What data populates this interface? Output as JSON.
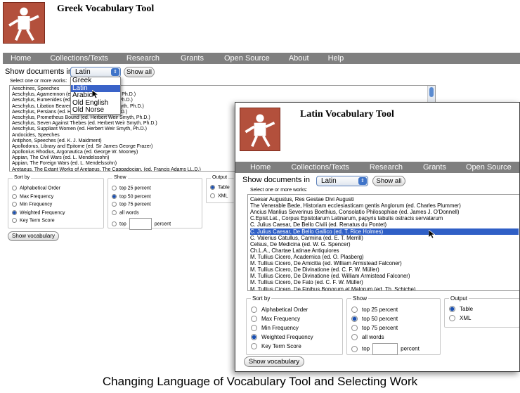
{
  "background": {
    "app_title": "Greek Vocabulary Tool",
    "nav": [
      "Home",
      "Collections/Texts",
      "Research",
      "Grants",
      "Open Source",
      "About",
      "Help"
    ],
    "show_documents_label": "Show documents in",
    "language_value": "Latin",
    "show_all_label": "Show all",
    "works_label": "Select one or more works:",
    "works": [
      "Aeschines, Speeches",
      "Aeschylus, Agamemnon (ed. Herbert Weir Smyth, Ph.D.)",
      "Aeschylus, Eumenides (ed. Herbert Weir Smyth, Ph.D.)",
      "Aeschylus, Libation Bearers (ed. Herbert Weir Smyth, Ph.D.)",
      "Aeschylus, Persians (ed. Herbert Weir Smyth, Ph.D.)",
      "Aeschylus, Prometheus Bound (ed. Herbert Weir Smyth, Ph.D.)",
      "Aeschylus, Seven Against Thebes (ed. Herbert Weir Smyth, Ph.D.)",
      "Aeschylus, Suppliant Women (ed. Herbert Weir Smyth, Ph.D.)",
      "Andocides, Speeches",
      "Antiphon, Speeches (ed. K. J. Maidment)",
      "Apollodorus, Library and Epitome (ed. Sir James George Frazer)",
      "Apollonius Rhodius, Argonautica (ed. George W. Mooney)",
      "Appian, The Civil Wars (ed. L. Mendelssohn)",
      "Appian, The Foreign Wars (ed. L. Mendelssohn)",
      "Aretaeus, The Extant Works of Aretaeus, The Cappadocian. (ed. Francis Adams LL.D.)"
    ],
    "language_options": [
      "Greek",
      "Latin",
      "Arabic",
      "Old English",
      "Old Norse"
    ],
    "language_highlighted": 1,
    "sort_by": {
      "legend": "Sort by",
      "options": [
        "Alphabetical Order",
        "Max Frequency",
        "Min Frequency",
        "Weighted Frequency",
        "Key Term Score"
      ],
      "selected": 3
    },
    "show": {
      "legend": "Show",
      "options": [
        "top 25 percent",
        "top 50 percent",
        "top 75 percent",
        "all words"
      ],
      "selected": 1,
      "top_label": "top",
      "percent_label": "percent"
    },
    "output": {
      "legend": "Output",
      "options": [
        "Table",
        "XML"
      ],
      "selected": 0
    },
    "show_vocabulary_label": "Show vocabulary"
  },
  "foreground": {
    "app_title": "Latin Vocabulary Tool",
    "nav": [
      "Home",
      "Collections/Texts",
      "Research",
      "Grants",
      "Open Source"
    ],
    "show_documents_label": "Show documents in",
    "language_value": "Latin",
    "show_all_label": "Show all",
    "works_label": "Select one or more works:",
    "works": [
      "Caesar Augustus, Res Gestae Divi Augusti",
      "The Venerable Bede, Historiam ecclesiasticam gentis Anglorum (ed. Charles Plummer)",
      "Ancius Manlius Severinus Boethius, Consolatio Philosophiae (ed. James J. O'Donnell)",
      "C.Epist.Lat., Corpus Epistolarum Latinarum, papyris tabulis ostracis servatarum",
      "C. Julius Caesar, De Bello Civili (ed. Renatus du Pontet)",
      "C. Julius Caesar, De Bello Gallico (ed. T. Rice Holmes)",
      "C. Valerius Catullus, Carmina (ed. E. T. Merrill)",
      "Celsus, De Medicina (ed. W. G. Spencer)",
      "Ch.L.A., Chartae Latinae Antiquiores",
      "M. Tullius Cicero, Academica (ed. O. Plasberg)",
      "M. Tullius Cicero, De Amicitia (ed. William Armistead Falconer)",
      "M. Tullius Cicero, De Divinatione (ed. C. F. W. Müller)",
      "M. Tullius Cicero, De Divinatione (ed. William Armistead Falconer)",
      "M. Tullius Cicero, De Fato (ed. C. F. W. Müller)",
      "M. Tullius Cicero, De Finibus Bonorum et Malorum (ed. Th. Schiche)"
    ],
    "selected_work": 5,
    "sort_by": {
      "legend": "Sort by",
      "options": [
        "Alphabetical Order",
        "Max Frequency",
        "Min Frequency",
        "Weighted Frequency",
        "Key Term Score"
      ],
      "selected": 3
    },
    "show": {
      "legend": "Show",
      "options": [
        "top 25 percent",
        "top 50 percent",
        "top 75 percent",
        "all words"
      ],
      "selected": 1,
      "top_label": "top",
      "percent_label": "percent"
    },
    "output": {
      "legend": "Output",
      "options": [
        "Table",
        "XML"
      ],
      "selected": 0
    },
    "show_vocabulary_label": "Show vocabulary"
  },
  "caption": "Changing Language of Vocabulary Tool and Selecting Work",
  "colors": {
    "nav_bg": "#7f7f7f",
    "logo_bg": "#b3503c",
    "selection": "#2f5fc6"
  }
}
